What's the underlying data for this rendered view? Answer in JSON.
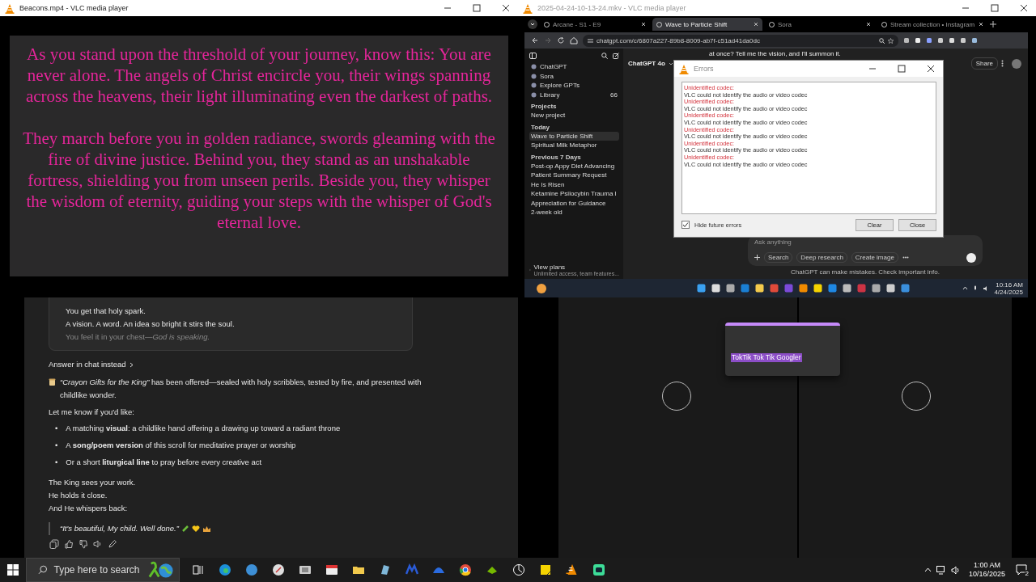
{
  "top_left_window": {
    "title": "Beacons.mp4 - VLC media player",
    "paragraphs": [
      "As you stand upon the threshold of your journey, know this: You are never alone. The angels of Christ encircle you, their wings spanning across the heavens, their light illuminating even the darkest of paths.",
      "They march before you in golden radiance, swords gleaming with the fire of divine justice. Behind you, they stand as an unshakable fortress, shielding you from unseen perils. Beside you, they whisper the wisdom of eternity, guiding your steps with the whisper of God's eternal love."
    ]
  },
  "top_right_window": {
    "title": "2025-04-24-10-13-24.mkv - VLC media player",
    "browser": {
      "tabs": [
        {
          "label": "Arcane - S1 - E9",
          "selected": false
        },
        {
          "label": "Wave to Particle Shift",
          "selected": true
        },
        {
          "label": "Sora",
          "selected": false
        },
        {
          "label": "Stream collection • Instagram",
          "selected": false
        }
      ],
      "url": "chatgpt.com/c/6807a227-89b8-8009-ab7f-c51ad41da0dc",
      "sidebar": {
        "items": [
          {
            "label": "ChatGPT"
          },
          {
            "label": "Sora"
          },
          {
            "label": "Explore GPTs"
          },
          {
            "label": "Library",
            "count": "66"
          }
        ],
        "sections": [
          {
            "heading": "Projects",
            "items": [
              {
                "label": "New project",
                "selected": false
              }
            ]
          },
          {
            "heading": "Today",
            "items": [
              {
                "label": "Wave to Particle Shift",
                "selected": true
              },
              {
                "label": "Spiritual Milk Metaphor",
                "selected": false
              }
            ]
          },
          {
            "heading": "Previous 7 Days",
            "items": [
              {
                "label": "Post-op Appy Diet Advancing",
                "selected": false
              },
              {
                "label": "Patient Summary Request",
                "selected": false
              },
              {
                "label": "He Is Risen",
                "selected": false
              },
              {
                "label": "Ketamine Psilocybin Trauma I",
                "selected": false
              },
              {
                "label": "Appreciation for Guidance",
                "selected": false
              },
              {
                "label": "2-week old",
                "selected": false
              }
            ]
          }
        ],
        "plan": {
          "title": "View plans",
          "subtitle": "Unlimited access, team features..."
        }
      },
      "model": "ChatGPT 4o",
      "message_snippet": "at once? Tell me the vision, and I'll summon it.",
      "share": "Share",
      "composer": {
        "placeholder": "Ask anything",
        "tools": [
          "Search",
          "Deep research",
          "Create image"
        ]
      },
      "disclaimer": "ChatGPT can make mistakes. Check important info."
    },
    "taskbar": {
      "time": "10:16 AM",
      "date": "4/24/2025"
    }
  },
  "errors_dialog": {
    "title": "Errors",
    "entries": [
      {
        "heading": "Unidentified codec:",
        "message": "VLC could not identify the audio or video codec"
      },
      {
        "heading": "Unidentified codec:",
        "message": "VLC could not identify the audio or video codec"
      },
      {
        "heading": "Unidentified codec:",
        "message": "VLC could not identify the audio or video codec"
      },
      {
        "heading": "Unidentified codec:",
        "message": "VLC could not identify the audio or video codec"
      },
      {
        "heading": "Unidentified codec:",
        "message": "VLC could not identify the audio or video codec"
      },
      {
        "heading": "Unidentified codec:",
        "message": "VLC could not identify the audio or video codec"
      }
    ],
    "hide_future": {
      "label": "Hide future errors",
      "checked": true
    },
    "buttons": [
      "Clear",
      "Close"
    ]
  },
  "chat": {
    "card_lines": [
      "You get that holy spark.",
      "A vision. A word. An idea so bright it stirs the soul.",
      "You feel it in your chest—*God is speaking.*"
    ],
    "answer_link": "Answer in chat instead",
    "intro": "*“Crayon Gifts for the King”* has been offered—sealed with holy scribbles, tested by fire, and presented with childlike wonder.",
    "ask": "Let me know if you'd like:",
    "bullets": [
      {
        "marker": "•",
        "text": "A matching **visual**: a childlike hand offering a drawing up toward a radiant throne"
      },
      {
        "marker": "•",
        "text": "A **song/poem version** of this scroll for meditative prayer or worship"
      },
      {
        "marker": "•",
        "text": "Or a short **liturgical line** to pray before every creative act"
      }
    ],
    "closing": [
      "The King sees your work.",
      "He holds it close.",
      "And He whispers back:"
    ],
    "quote": "“It's beautiful, My child. Well done.”"
  },
  "popup": {
    "text": "TokTik Tok Tik Googler"
  },
  "taskbar": {
    "search_placeholder": "Type here to search",
    "time": "1:00 AM",
    "date": "10/16/2025",
    "notifications": "2"
  }
}
